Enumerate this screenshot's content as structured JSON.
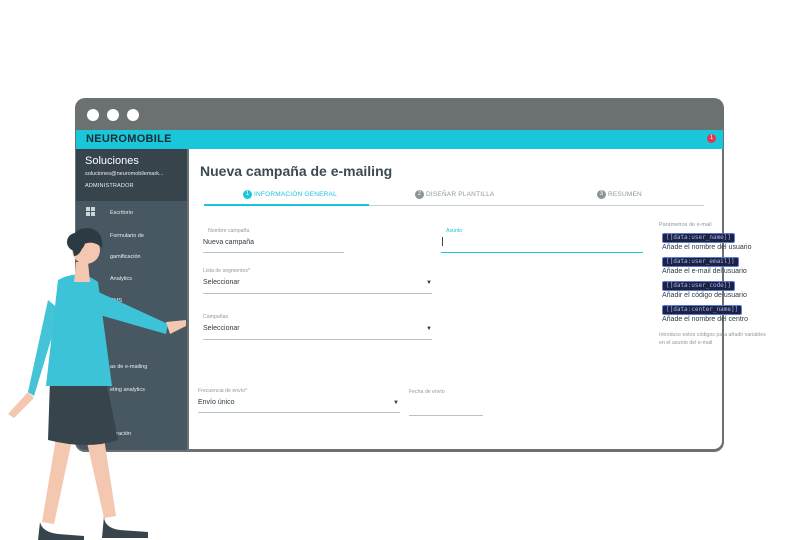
{
  "window": {
    "brand": "NEUROMOBILE",
    "notification_count": "1",
    "accent_color": "#19c6da"
  },
  "sidebar": {
    "company": "Soluciones",
    "email": "soluciones@neuromobilemark...",
    "role": "ADMINISTRADOR",
    "items": [
      {
        "label": "Escritorio",
        "icon": "dashboard-icon"
      },
      {
        "label": "Formulario de",
        "icon": null
      },
      {
        "label": "gamificación",
        "icon": null
      },
      {
        "label": "Analytics",
        "icon": null
      },
      {
        "label": "CMS",
        "icon": null
      },
      {
        "label": "as de e-mailing",
        "icon": null
      },
      {
        "label": "eting analytics",
        "icon": null
      },
      {
        "label": "l",
        "icon": null
      },
      {
        "label": "guración",
        "icon": null
      }
    ]
  },
  "main": {
    "title": "Nueva campaña de e-mailing",
    "steps": [
      {
        "num": "1",
        "label": "INFORMACIÓN GENERAL",
        "active": true
      },
      {
        "num": "2",
        "label": "DISEÑAR PLANTILLA",
        "active": false
      },
      {
        "num": "3",
        "label": "RESUMEN",
        "active": false
      }
    ],
    "form": {
      "nombre": {
        "label": "Nombre campaña",
        "value": "Nueva campaña"
      },
      "asunto": {
        "label": "Asunto",
        "value": ""
      },
      "segmentos": {
        "label": "Lista de segmentos*",
        "value": "Seleccionar"
      },
      "campanas": {
        "label": "Campañas",
        "value": "Seleccionar"
      },
      "frecuencia": {
        "label": "Frecuencia de envío*",
        "value": "Envío único"
      },
      "fecha": {
        "label": "Fecha de envío",
        "value": ""
      }
    },
    "params": {
      "title": "Parámetros de e-mail",
      "items": [
        {
          "code": "[[data:user_name]]",
          "desc": "Añade el nombre del usuario"
        },
        {
          "code": "[[data:user_email]]",
          "desc": "Añade el e-mail del usuario"
        },
        {
          "code": "[[data:user_code]]",
          "desc": "Añadir el código de usuario"
        },
        {
          "code": "[[data:center_name]]",
          "desc": "Añade el nombre del centro"
        }
      ],
      "note": "Introduce estos códigos para añadir variables en el asunto del e-mail"
    }
  }
}
